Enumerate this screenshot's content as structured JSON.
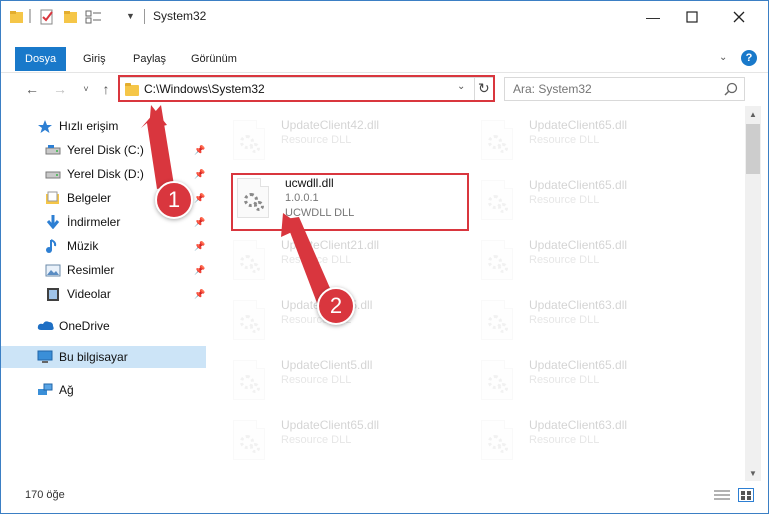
{
  "window": {
    "title": "System32"
  },
  "ribbon": {
    "tabs": [
      {
        "label": "Dosya",
        "active": true
      },
      {
        "label": "Giriş",
        "active": false
      },
      {
        "label": "Paylaş",
        "active": false
      },
      {
        "label": "Görünüm",
        "active": false
      }
    ],
    "help_label": "?"
  },
  "nav": {
    "address": "C:\\Windows\\System32",
    "search_placeholder": "Ara: System32"
  },
  "sidebar": {
    "items": [
      {
        "label": "Hızlı erişim",
        "icon": "star-icon",
        "pinned": false
      },
      {
        "label": "Yerel Disk (C:)",
        "icon": "drive-icon",
        "pinned": true
      },
      {
        "label": "Yerel Disk (D:)",
        "icon": "drive-icon",
        "pinned": true
      },
      {
        "label": "Belgeler",
        "icon": "documents-icon",
        "pinned": true
      },
      {
        "label": "İndirmeler",
        "icon": "download-icon",
        "pinned": true
      },
      {
        "label": "Müzik",
        "icon": "music-icon",
        "pinned": true
      },
      {
        "label": "Resimler",
        "icon": "pictures-icon",
        "pinned": true
      },
      {
        "label": "Videolar",
        "icon": "video-icon",
        "pinned": true
      },
      {
        "label": "OneDrive",
        "icon": "cloud-icon",
        "pinned": false
      },
      {
        "label": "Bu bilgisayar",
        "icon": "computer-icon",
        "pinned": false
      },
      {
        "label": "Ağ",
        "icon": "network-icon",
        "pinned": false
      }
    ]
  },
  "files": {
    "left": [
      {
        "name": "UpdateClient42.dll",
        "desc": "Resource DLL"
      },
      {
        "name": "UpdateClient21.dll",
        "desc": "Resource DLL"
      },
      {
        "name": "UpdateClient5.dll",
        "desc": "Resource DLL"
      },
      {
        "name": "UpdateClient5.dll",
        "desc": "Resource DLL"
      },
      {
        "name": "UpdateClient65.dll",
        "desc": "Resource DLL"
      }
    ],
    "right": [
      {
        "name": "UpdateClient65.dll",
        "desc": "Resource DLL"
      },
      {
        "name": "UpdateClient65.dll",
        "desc": "Resource DLL"
      },
      {
        "name": "UpdateClient65.dll",
        "desc": "Resource DLL"
      },
      {
        "name": "UpdateClient63.dll",
        "desc": "Resource DLL"
      },
      {
        "name": "UpdateClient65.dll",
        "desc": "Resource DLL"
      },
      {
        "name": "UpdateClient63.dll",
        "desc": "Resource DLL"
      }
    ],
    "featured": {
      "name": "ucwdll.dll",
      "version": "1.0.0.1",
      "desc": "UCWDLL DLL"
    }
  },
  "callouts": {
    "one": "1",
    "two": "2"
  },
  "status": {
    "count": "170 öğe"
  },
  "colors": {
    "accent": "#1979ca",
    "highlight": "#d9363e",
    "selected": "#cce4f7"
  }
}
